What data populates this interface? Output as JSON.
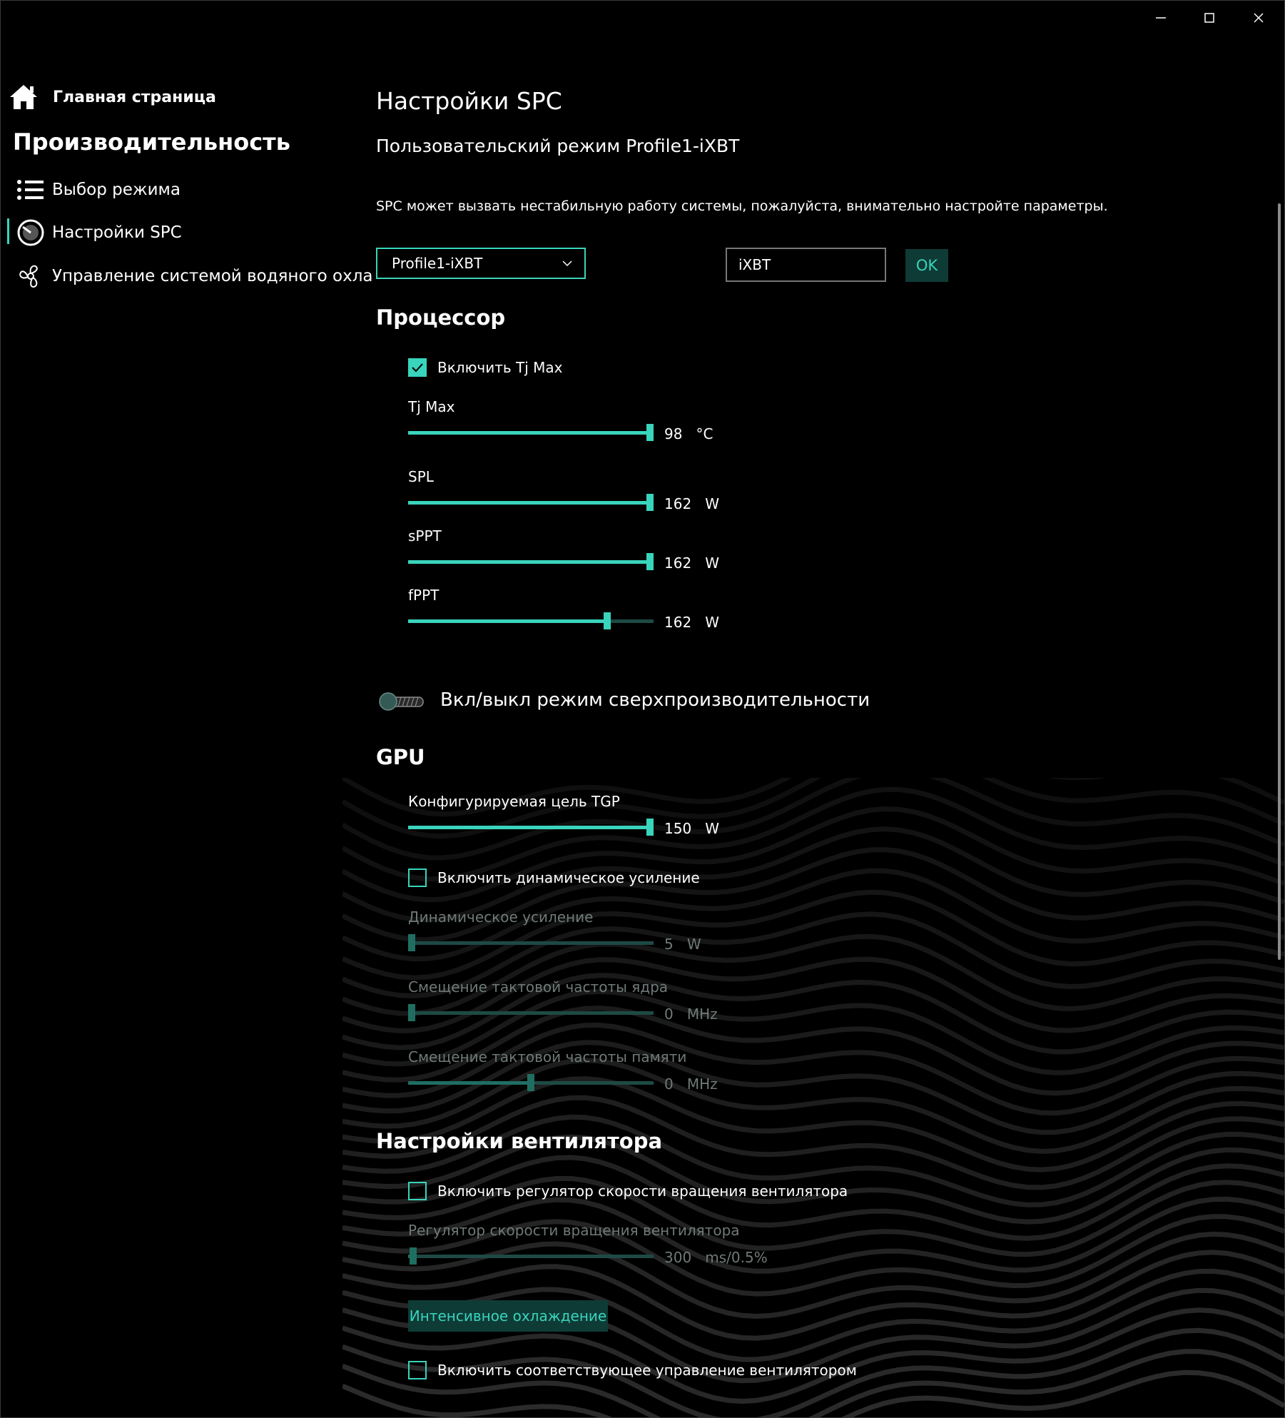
{
  "window": {
    "controls": [
      "minimize-icon",
      "maximize-icon",
      "close-icon"
    ]
  },
  "sidebar": {
    "home_label": "Главная страница",
    "section_title": "Производительность",
    "items": [
      {
        "label": "Выбор режима",
        "icon": "list-icon"
      },
      {
        "label": "Настройки SPC",
        "icon": "gauge-icon",
        "active": true
      },
      {
        "label": "Управление системой водяного охла",
        "icon": "fan-icon"
      }
    ]
  },
  "main": {
    "title": "Настройки SPC",
    "subtitle": "Пользовательский режим Profile1-iXBT",
    "warning": "SPC может вызвать нестабильную работу системы, пожалуйста, внимательно настройте параметры.",
    "profile_select": "Profile1-iXBT",
    "name_input": "iXBT",
    "ok_label": "OK"
  },
  "cpu": {
    "title": "Процессор",
    "tjmax_checkbox": {
      "label": "Включить Tj Max",
      "checked": true
    },
    "sliders": [
      {
        "label": "Tj Max",
        "value": "98",
        "unit": "°C",
        "fill": 1.0
      },
      {
        "label": "SPL",
        "value": "162",
        "unit": "W",
        "fill": 1.0
      },
      {
        "label": "sPPT",
        "value": "162",
        "unit": "W",
        "fill": 1.0
      },
      {
        "label": "fPPT",
        "value": "162",
        "unit": "W",
        "fill": 0.81
      }
    ]
  },
  "overdrive": {
    "label": "Вкл/выкл режим сверхпроизводительности",
    "on": false
  },
  "gpu": {
    "title": "GPU",
    "tgp": {
      "label": "Конфигурируемая цель TGP",
      "value": "150",
      "unit": "W",
      "fill": 1.0
    },
    "dynamic_checkbox": {
      "label": "Включить динамическое усиление",
      "checked": false
    },
    "dynamic_boost": {
      "label": "Динамическое усиление",
      "value": "5",
      "unit": "W",
      "fill": 0.0
    },
    "core_offset": {
      "label": "Смещение тактовой частоты ядра",
      "value": "0",
      "unit": "MHz",
      "fill": 0.0
    },
    "mem_offset": {
      "label": "Смещение тактовой частоты памяти",
      "value": "0",
      "unit": "MHz",
      "fill": 0.5
    }
  },
  "fan": {
    "title": "Настройки вентилятора",
    "speed_checkbox": {
      "label": "Включить регулятор скорости вращения вентилятора",
      "checked": false
    },
    "speed_slider": {
      "label": "Регулятор скорости вращения вентилятора",
      "value": "300",
      "unit": "ms/0.5%",
      "fill": 0.02
    },
    "intense_button": "Интенсивное охлаждение",
    "match_checkbox": {
      "label": "Включить соответствующее управление вентилятором",
      "checked": false
    }
  },
  "colors": {
    "accent": "#39d4bc",
    "track": "#1d4a44",
    "button_bg": "#0f3b36",
    "background": "#000000"
  }
}
